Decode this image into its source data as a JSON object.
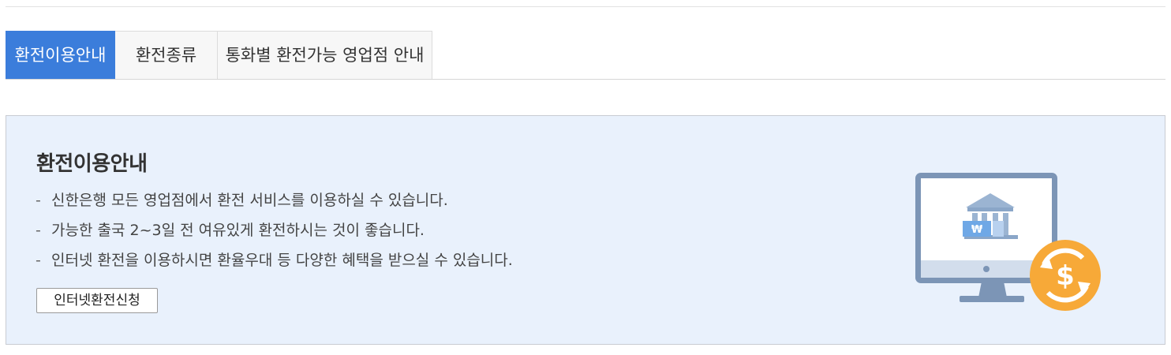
{
  "tabs": [
    {
      "label": "환전이용안내",
      "active": true
    },
    {
      "label": "환전종류",
      "active": false
    },
    {
      "label": "통화별 환전가능 영업점 안내",
      "active": false
    }
  ],
  "info": {
    "title": "환전이용안내",
    "bullet": "-",
    "items": [
      "신한은행 모든 영업점에서 환전 서비스를 이용하실 수 있습니다.",
      "가능한 출국 2~3일 전 여유있게 환전하시는 것이 좋습니다.",
      "인터넷 환전을 이용하시면 환율우대 등 다양한 혜택을 받으실 수 있습니다."
    ],
    "button_label": "인터넷환전신청"
  },
  "illustration": {
    "icon": "bank-monitor-exchange-icon",
    "won_symbol": "₩",
    "dollar_symbol": "$",
    "colors": {
      "monitor": "#7c95b6",
      "screen": "#ffffff",
      "bank": "#9bb4d2",
      "badge": "#f7a938",
      "card": "#6fa8e6"
    }
  },
  "colors": {
    "tab_active": "#3b7ddb",
    "panel_bg": "#e9f1fc"
  }
}
